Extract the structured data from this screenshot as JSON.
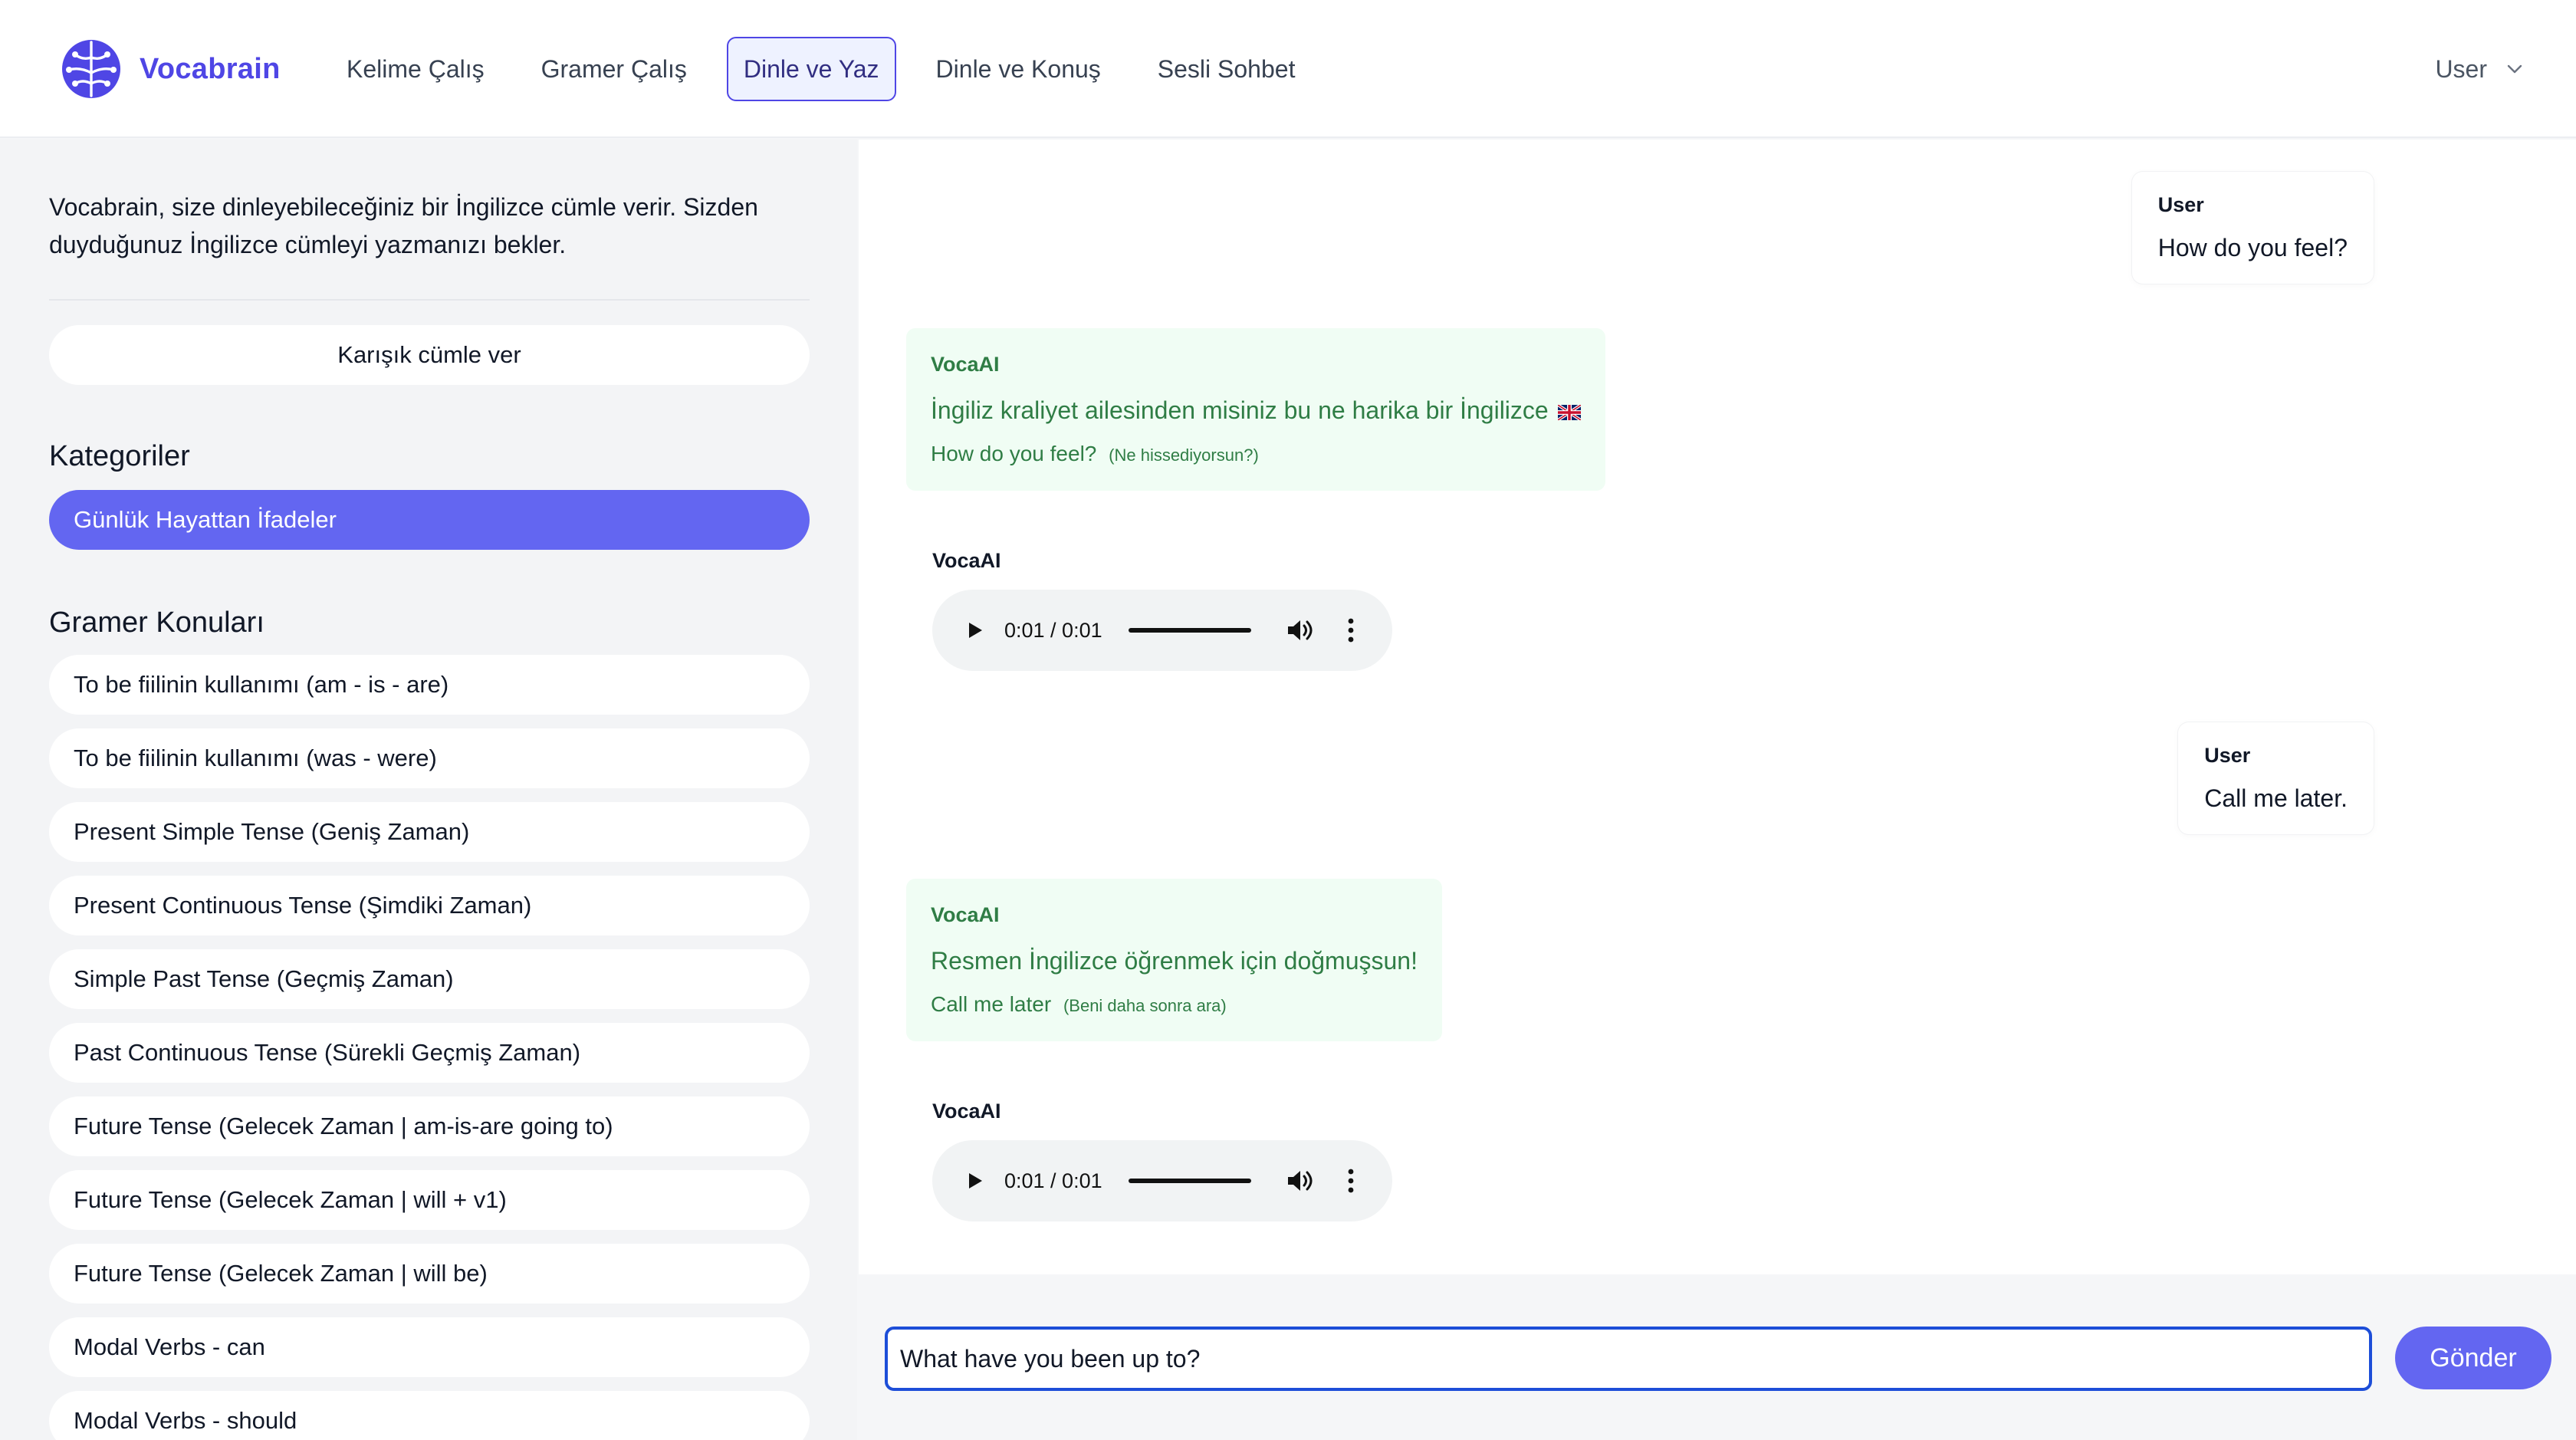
{
  "brand": {
    "name": "Vocabrain"
  },
  "nav": [
    {
      "label": "Kelime Çalış",
      "active": false
    },
    {
      "label": "Gramer Çalış",
      "active": false
    },
    {
      "label": "Dinle ve Yaz",
      "active": true
    },
    {
      "label": "Dinle ve Konuş",
      "active": false
    },
    {
      "label": "Sesli Sohbet",
      "active": false
    }
  ],
  "user_menu": {
    "label": "User",
    "icon": "chevron-down-icon"
  },
  "sidebar": {
    "intro": "Vocabrain, size dinleyebileceğiniz bir İngilizce cümle verir. Sizden duyduğunuz İngilizce cümleyi yazmanızı bekler.",
    "shuffle_label": "Karışık cümle ver",
    "categories_title": "Kategoriler",
    "categories": [
      "Günlük Hayattan İfadeler"
    ],
    "grammar_title": "Gramer Konuları",
    "grammar_topics": [
      "To be fiilinin kullanımı (am - is - are)",
      "To be fiilinin kullanımı (was - were)",
      "Present Simple Tense (Geniş Zaman)",
      "Present Continuous Tense (Şimdiki Zaman)",
      "Simple Past Tense (Geçmiş Zaman)",
      "Past Continuous Tense (Sürekli Geçmiş Zaman)",
      "Future Tense (Gelecek Zaman | am-is-are going to)",
      "Future Tense (Gelecek Zaman | will + v1)",
      "Future Tense (Gelecek Zaman | will be)",
      "Modal Verbs - can",
      "Modal Verbs - should"
    ]
  },
  "chat": {
    "messages": [
      {
        "type": "user",
        "sender": "User",
        "text": "How do you feel?"
      },
      {
        "type": "ai",
        "sender": "VocaAI",
        "text": "İngiliz kraliyet ailesinden misiniz bu ne harika bir İngilizce",
        "sentence": "How do you feel?",
        "translation": "(Ne hissediyorsun?)",
        "flag_icon": "uk-flag-icon"
      },
      {
        "type": "audio",
        "sender": "VocaAI",
        "time": "0:01 / 0:01"
      },
      {
        "type": "user",
        "sender": "User",
        "text": "Call me later."
      },
      {
        "type": "ai",
        "sender": "VocaAI",
        "text": "Resmen İngilizce öğrenmek için doğmuşsun!",
        "sentence": "Call me later",
        "translation": "(Beni daha sonra ara)"
      },
      {
        "type": "audio",
        "sender": "VocaAI",
        "time": "0:01 / 0:01"
      }
    ]
  },
  "composer": {
    "value": "What have you been up to?",
    "send_label": "Gönder"
  },
  "colors": {
    "accent": "#6366f1",
    "brand": "#4f46e5",
    "ai_text": "#2f7d45",
    "ai_bubble": "#f0fdf4",
    "input_focus": "#1d4ed8"
  }
}
